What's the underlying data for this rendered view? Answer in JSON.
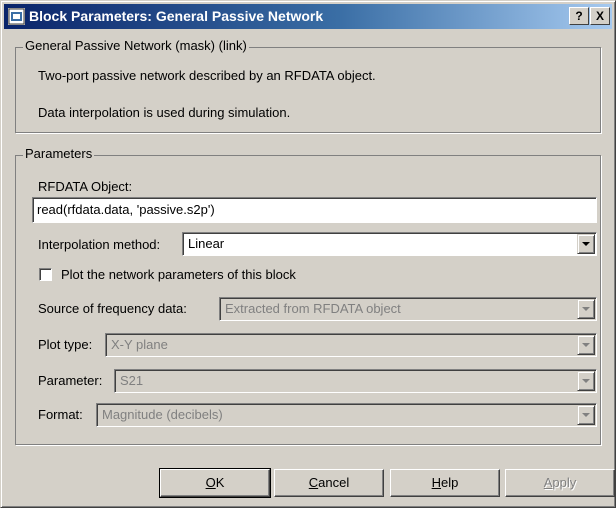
{
  "window": {
    "title": "Block Parameters: General Passive Network",
    "help_button": "?",
    "close_button": "X"
  },
  "mask_group": {
    "legend": "General Passive Network (mask) (link)",
    "description_line1": "Two-port passive network described by an RFDATA object.",
    "description_line2": "Data interpolation is used during simulation."
  },
  "params_group": {
    "legend": "Parameters",
    "rfdata_label": "RFDATA Object:",
    "rfdata_value": "read(rfdata.data, 'passive.s2p')",
    "interp_label": "Interpolation method:",
    "interp_value": "Linear",
    "plot_checkbox_label": "Plot the network parameters of this block",
    "plot_checked": false,
    "freq_source_label": "Source of frequency data:",
    "freq_source_value": "Extracted from RFDATA object",
    "plot_type_label": "Plot type:",
    "plot_type_value": "X-Y plane",
    "parameter_label": "Parameter:",
    "parameter_value": "S21",
    "format_label": "Format:",
    "format_value": "Magnitude (decibels)"
  },
  "buttons": {
    "ok": "OK",
    "cancel": "Cancel",
    "help": "Help",
    "apply": "Apply"
  },
  "colors": {
    "titlebar_start": "#0a246a",
    "titlebar_end": "#a6caf0",
    "dialog_face": "#d4d0c8",
    "disabled_text": "#808080"
  }
}
